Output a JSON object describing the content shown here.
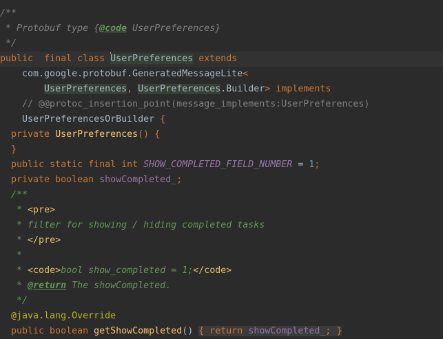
{
  "code": {
    "l1": "/**",
    "l2_prefix": " * Protobuf type {",
    "l2_tag": "@code",
    "l2_type": " UserPreferences",
    "l2_suffix": "}",
    "l3": " */",
    "l4_public": "public",
    "l4_final": "final",
    "l4_class": "class",
    "l4_name": "UserPreferences",
    "l4_extends": "extends",
    "l5_pkg": "com.google.protobuf.GeneratedMessageLite",
    "l5_lt": "<",
    "l6_type1": "UserPreferences",
    "l6_comma": ", ",
    "l6_type2": "UserPreferences",
    "l6_dot": ".Builder",
    "l6_gt": ">",
    "l6_implements": "implements",
    "l7": "// @@protoc_insertion_point(message_implements:UserPreferences)",
    "l8_iface": "UserPreferencesOrBuilder",
    "l8_brace": "{",
    "l9_private": "private",
    "l9_ctor": "UserPreferences",
    "l9_paren": "() {",
    "l10": "}",
    "l11_mods": "public static final int",
    "l11_const": "SHOW_COMPLETED_FIELD_NUMBER",
    "l11_eq": " = ",
    "l11_val": "1",
    "l11_semi": ";",
    "l12_mods": "private boolean",
    "l12_field": "showCompleted_",
    "l12_semi": ";",
    "l13": "/**",
    "l14_star": " * ",
    "l14_tag": "<pre>",
    "l15": " * filter for showing / hiding completed tasks",
    "l16_star": " * ",
    "l16_tag": "</pre>",
    "l17": " *",
    "l18_star": " * ",
    "l18_open": "<code>",
    "l18_text": "bool show_completed = 1;",
    "l18_close": "</code>",
    "l19_star": " * ",
    "l19_tag": "@return",
    "l19_text": " The showCompleted.",
    "l20": " */",
    "l21_at": "@java.lang.",
    "l21_ann": "Override",
    "l22_mods": "public boolean",
    "l22_method": "getShowCompleted",
    "l22_paren": "()",
    "l22_ob": "{",
    "l22_return": "return",
    "l22_field": "showCompleted_",
    "l22_semi": ";",
    "l22_cb": "}"
  },
  "colors": {
    "background": "#2b2b2b",
    "keyword": "#cc7832",
    "comment": "#808080",
    "javadoc": "#629755",
    "method": "#ffc66d",
    "field": "#9876aa",
    "number": "#6897bb",
    "annotation": "#bbb529"
  }
}
